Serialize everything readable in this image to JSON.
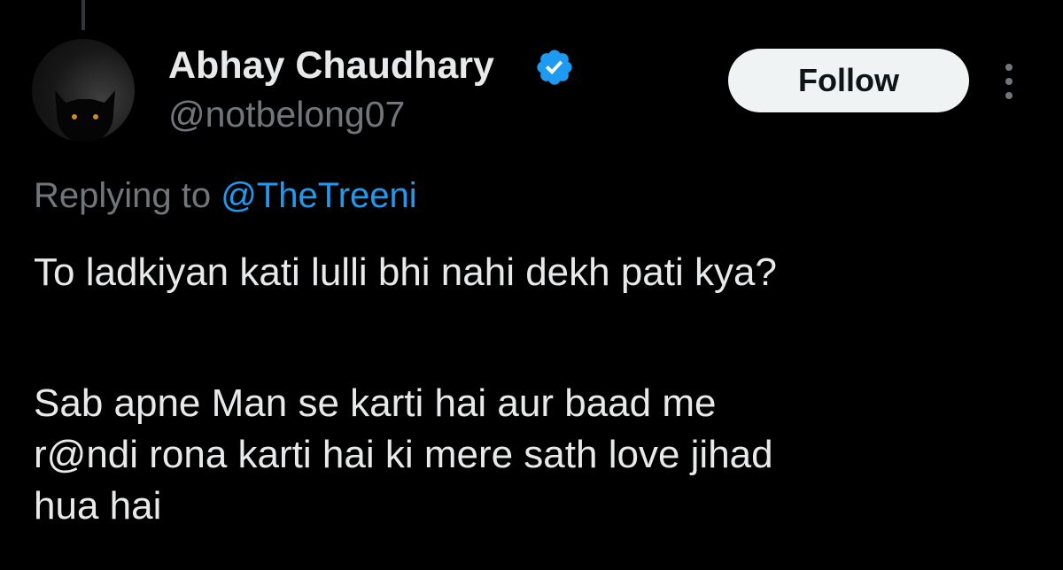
{
  "author": {
    "display_name": "Abhay Chaudhary",
    "handle": "@notbelong07",
    "verified": true,
    "avatar_icon": "black-cat-avatar"
  },
  "actions": {
    "follow_label": "Follow",
    "more_icon": "more-vertical-icon"
  },
  "reply": {
    "prefix": "Replying to",
    "mention": "@TheTreeni"
  },
  "tweet": {
    "paragraph_1": "To ladkiyan kati lulli bhi nahi dekh pati kya?",
    "paragraph_2_lines": [
      "Sab apne Man se karti hai aur baad me",
      "r@ndi rona karti hai ki mere sath love jihad",
      "hua hai"
    ]
  },
  "colors": {
    "background": "#000000",
    "primary_text": "#e7e9ea",
    "secondary_text": "#71767b",
    "accent_blue": "#1d9bf0",
    "follow_bg": "#eff3f4",
    "thread_line": "#333639"
  }
}
